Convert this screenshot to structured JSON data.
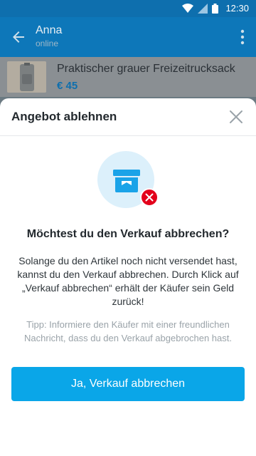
{
  "statusbar": {
    "time": "12:30"
  },
  "appbar": {
    "name": "Anna",
    "status": "online"
  },
  "item": {
    "title": "Praktischer grauer Freizeitrucksack",
    "price": "€ 45"
  },
  "dialog": {
    "title": "Angebot ablehnen",
    "headline": "Möchtest du den Verkauf abbrechen?",
    "body": "Solange du den Artikel noch nicht versendet hast, kannst du den Verkauf abbrechen. Durch Klick auf „Verkauf abbrechen“ erhält der Käufer sein Geld zurück!",
    "tip": "Tipp: Informiere den Käufer mit einer freundlichen Nachricht, dass du den Verkauf abgebrochen hast.",
    "confirm_label": "Ja, Verkauf abbrechen"
  },
  "colors": {
    "accent": "#0aa6e8",
    "appbar": "#0d77b9",
    "error": "#e3001b"
  },
  "icons": [
    "wifi-icon",
    "signal-icon",
    "battery-icon",
    "back-arrow-icon",
    "more-vert-icon",
    "close-icon",
    "archive-box-icon",
    "error-badge-icon"
  ]
}
